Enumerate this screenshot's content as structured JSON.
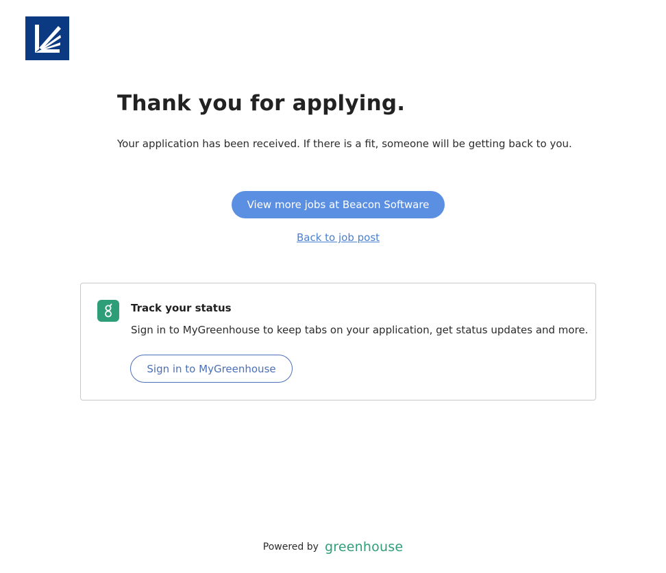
{
  "brand": {
    "logo_icon": "company-logo-icon",
    "logo_color": "#0b3a82"
  },
  "confirmation": {
    "headline": "Thank you for applying.",
    "message": "Your application has been received. If there is a fit, someone will be getting back to you.",
    "view_jobs_label": "View more jobs at Beacon Software",
    "back_link_label": "Back to job post"
  },
  "track_status": {
    "icon": "greenhouse-icon",
    "title": "Track your status",
    "description": "Sign in to MyGreenhouse to keep tabs on your application, get status updates and more.",
    "signin_label": "Sign in to MyGreenhouse"
  },
  "footer": {
    "powered_by": "Powered by",
    "brand_name": "greenhouse"
  },
  "colors": {
    "primary_button": "#5b8fe2",
    "link": "#4a7fd0",
    "greenhouse_green": "#2e9e79"
  }
}
